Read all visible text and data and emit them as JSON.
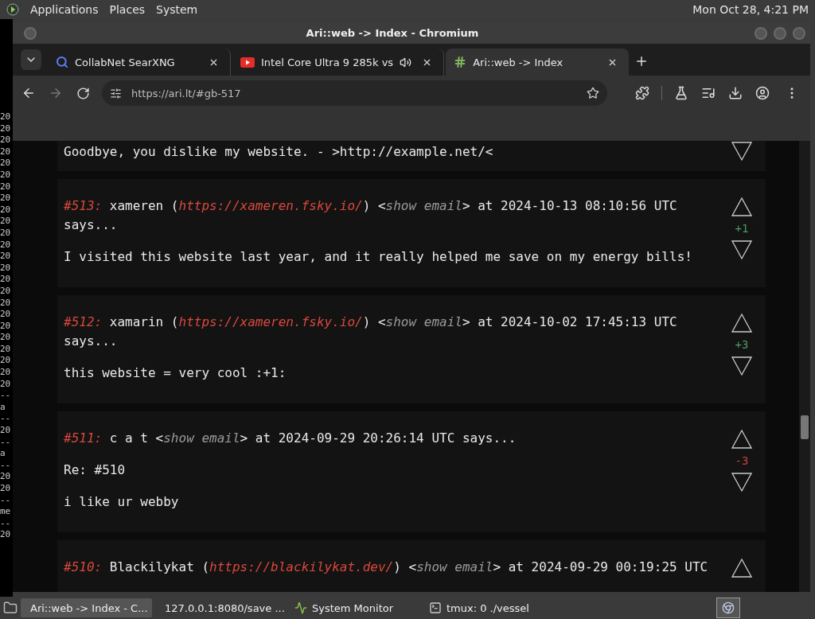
{
  "top_panel": {
    "menus": [
      "Applications",
      "Places",
      "System"
    ],
    "clock": "Mon Oct 28,  4:21 PM"
  },
  "terminal_lines": [
    "20",
    "20",
    "20",
    "20",
    "20",
    "20",
    "20",
    "20",
    "20",
    "20",
    "20",
    "20",
    "20",
    "20",
    "20",
    "20",
    "20",
    "20",
    "20",
    "20",
    "20",
    "20",
    "20",
    "20",
    "--",
    "a",
    "--",
    "20",
    "--",
    "a",
    "--",
    "20",
    "20",
    "--",
    "me",
    "--",
    "20"
  ],
  "window": {
    "title": "Ari::web -> Index - Chromium"
  },
  "tabs": [
    {
      "title": "CollabNet SearXNG",
      "kind": "search",
      "selected": false,
      "audio": false
    },
    {
      "title": "Intel Core Ultra 9 285k vs",
      "kind": "video",
      "selected": false,
      "audio": true
    },
    {
      "title": "Ari::web -> Index",
      "kind": "site",
      "selected": true,
      "audio": false
    }
  ],
  "address_bar": {
    "value": "https://ari.lt/#gb-517"
  },
  "comments": [
    {
      "kind": "cut-top",
      "paragraphs": [
        "Goodbye, you dislike my website. - >http://example.net/<"
      ]
    },
    {
      "kind": "full",
      "header": [
        {
          "kind": "number",
          "text": "#513:"
        },
        {
          "kind": "plain",
          "text": " xameren ("
        },
        {
          "kind": "link",
          "text": "https://xameren.fsky.io/"
        },
        {
          "kind": "plain",
          "text": ") <"
        },
        {
          "kind": "email",
          "text": "show email"
        },
        {
          "kind": "plain",
          "text": "> at 2024-10-13 08:10:56 UTC says..."
        }
      ],
      "paragraphs": [
        "I visited this website last year, and it really helped me save on my energy bills!"
      ],
      "score": {
        "text": "+1",
        "color": "#4f9a62"
      }
    },
    {
      "kind": "full",
      "header": [
        {
          "kind": "number",
          "text": "#512:"
        },
        {
          "kind": "plain",
          "text": " xamarin ("
        },
        {
          "kind": "link",
          "text": "https://xameren.fsky.io/"
        },
        {
          "kind": "plain",
          "text": ") <"
        },
        {
          "kind": "email",
          "text": "show email"
        },
        {
          "kind": "plain",
          "text": "> at 2024-10-02 17:45:13 UTC says..."
        }
      ],
      "paragraphs": [
        "this website = very cool :+1:"
      ],
      "score": {
        "text": "+3",
        "color": "#4f9a62"
      }
    },
    {
      "kind": "full",
      "header": [
        {
          "kind": "number",
          "text": "#511:"
        },
        {
          "kind": "plain",
          "text": " c a t <"
        },
        {
          "kind": "email",
          "text": "show email"
        },
        {
          "kind": "plain",
          "text": "> at 2024-09-29 20:26:14 UTC says..."
        }
      ],
      "paragraphs": [
        "Re: #510",
        "i like ur webby"
      ],
      "score": {
        "text": "-3",
        "color": "#c8413c"
      }
    },
    {
      "kind": "cut-bottom",
      "header": [
        {
          "kind": "number",
          "text": "#510:"
        },
        {
          "kind": "plain",
          "text": " Blackilykat ("
        },
        {
          "kind": "link",
          "text": "https://blackilykat.dev/"
        },
        {
          "kind": "plain",
          "text": ") <"
        },
        {
          "kind": "email",
          "text": "show email"
        },
        {
          "kind": "plain",
          "text": "> at 2024-09-29 00:19:25 UTC"
        }
      ]
    }
  ],
  "taskbar": [
    {
      "title": "Ari::web -> Index - C...",
      "kind": "browser",
      "selected": true
    },
    {
      "title": "127.0.0.1:8080/save ...",
      "kind": "browser",
      "selected": false
    },
    {
      "title": "System Monitor",
      "kind": "monitor",
      "selected": false
    },
    {
      "title": "tmux: 0 ./vessel",
      "kind": "terminal",
      "selected": false
    }
  ]
}
